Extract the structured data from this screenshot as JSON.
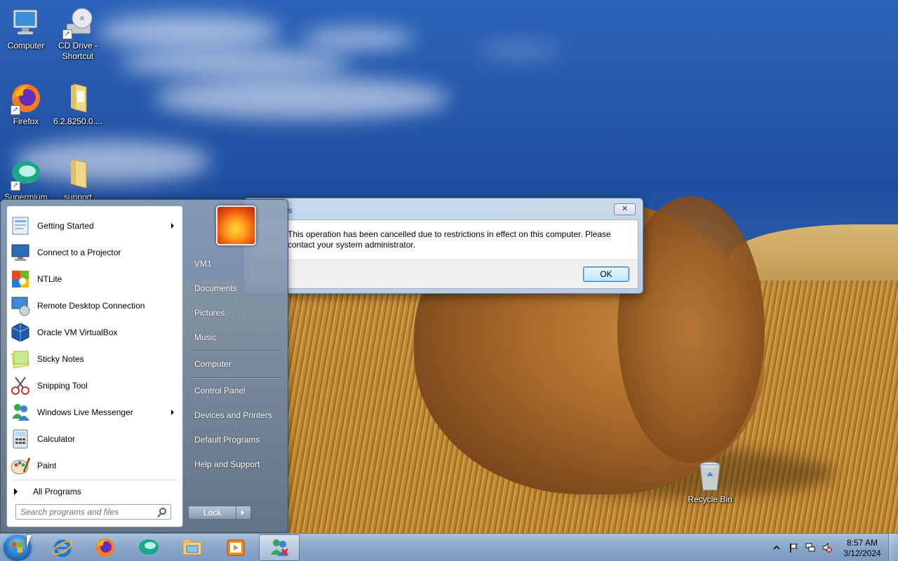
{
  "desktop": {
    "icons": [
      {
        "label": "Computer",
        "icon": "computer-icon",
        "shortcut": false
      },
      {
        "label": "CD Drive - Shortcut",
        "icon": "cd-drive-icon",
        "shortcut": true
      },
      {
        "label": "Firefox",
        "icon": "firefox-icon",
        "shortcut": true
      },
      {
        "label": "6.2.8250.0....",
        "icon": "folder-icon",
        "shortcut": false
      },
      {
        "label": "Supermium",
        "icon": "supermium-icon",
        "shortcut": true
      },
      {
        "label": "support",
        "icon": "folder-icon",
        "shortcut": false
      },
      {
        "label": "Recycle Bin",
        "icon": "recycle-bin-icon",
        "shortcut": false
      }
    ]
  },
  "dialog": {
    "title": "ns",
    "close_label": "✕",
    "message": "This operation has been cancelled due to restrictions in effect on this computer. Please contact your system administrator.",
    "ok_label": "OK"
  },
  "start_menu": {
    "programs": [
      {
        "label": "Getting Started",
        "icon": "getting-started-icon",
        "submenu": true
      },
      {
        "label": "Connect to a Projector",
        "icon": "projector-icon",
        "submenu": false
      },
      {
        "label": "NTLite",
        "icon": "ntlite-icon",
        "submenu": false
      },
      {
        "label": "Remote Desktop Connection",
        "icon": "remote-desktop-icon",
        "submenu": false
      },
      {
        "label": "Oracle VM VirtualBox",
        "icon": "virtualbox-icon",
        "submenu": false
      },
      {
        "label": "Sticky Notes",
        "icon": "sticky-notes-icon",
        "submenu": false
      },
      {
        "label": "Snipping Tool",
        "icon": "snipping-tool-icon",
        "submenu": false
      },
      {
        "label": "Windows Live Messenger",
        "icon": "messenger-icon",
        "submenu": true
      },
      {
        "label": "Calculator",
        "icon": "calculator-icon",
        "submenu": false
      },
      {
        "label": "Paint",
        "icon": "paint-icon",
        "submenu": false
      }
    ],
    "all_programs_label": "All Programs",
    "search_placeholder": "Search programs and files",
    "right_links": [
      {
        "label": "VM1"
      },
      {
        "label": "Documents"
      },
      {
        "label": "Pictures"
      },
      {
        "label": "Music"
      },
      {
        "label": "Computer"
      },
      {
        "label": "Control Panel"
      },
      {
        "label": "Devices and Printers"
      },
      {
        "label": "Default Programs"
      },
      {
        "label": "Help and Support"
      }
    ],
    "lock_label": "Lock"
  },
  "taskbar": {
    "pinned": [
      "internet-explorer-icon",
      "firefox-icon",
      "supermium-icon",
      "file-explorer-icon",
      "media-player-icon",
      "messenger-icon"
    ],
    "active_item": "messenger-icon",
    "tray_icons": [
      "show-hidden-icons-icon",
      "action-center-flag-icon",
      "network-icon",
      "volume-muted-icon"
    ],
    "clock_time": "8:57 AM",
    "clock_date": "3/12/2024"
  },
  "colors": {
    "accent": "#3c7fb1",
    "taskbar": "#8aa7c9",
    "sky": "#1f4fa0"
  }
}
